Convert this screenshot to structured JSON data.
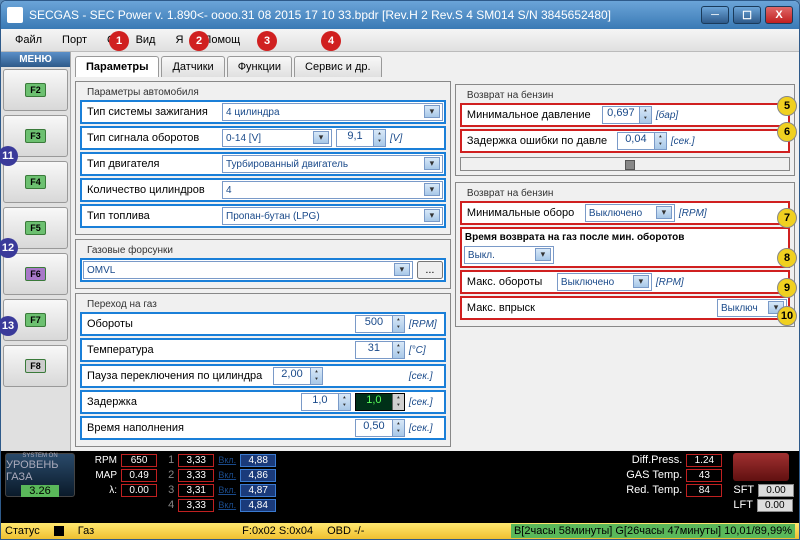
{
  "title": "SECGAS - SEC Power v. 1.890<- oooo.31 08 2015 17 10 33.bpdr [Rev.H 2 Rev.S 4 SM014  S/N 3845652480]",
  "menu": [
    "Файл",
    "Порт",
    "О",
    "Вид",
    "Я",
    "Помощ"
  ],
  "sidebar_header": "МЕНЮ",
  "fkeys": [
    "F2",
    "F3",
    "F4",
    "F5",
    "F6",
    "F7",
    "F8"
  ],
  "tabs": [
    "Параметры",
    "Датчики",
    "Функции",
    "Сервис и др."
  ],
  "group1": {
    "legend": "Параметры автомобиля",
    "ignition_label": "Тип системы зажигания",
    "ignition_value": "4 цилиндра",
    "rpm_signal_label": "Тип сигнала оборотов",
    "rpm_signal_value": "0-14 [V]",
    "rpm_signal_extra": "9,1",
    "rpm_signal_unit": "[V]",
    "engine_label": "Тип двигателя",
    "engine_value": "Турбированный двигатель",
    "cyl_label": "Количество цилиндров",
    "cyl_value": "4",
    "fuel_label": "Тип топлива",
    "fuel_value": "Пропан-бутан (LPG)"
  },
  "group2": {
    "legend": "Газовые форсунки",
    "injector_value": "OMVL",
    "btn": "..."
  },
  "group3": {
    "legend": "Переход на газ",
    "rpm_label": "Обороты",
    "rpm_value": "500",
    "rpm_unit": "[RPM]",
    "temp_label": "Температура",
    "temp_value": "31",
    "temp_unit": "[°C]",
    "pause_label": "Пауза переключения по цилиндра",
    "pause_value": "2,00",
    "pause_unit": "[сек.]",
    "delay_label": "Задержка",
    "delay_value": "1,0",
    "delay_dark": "1,0",
    "delay_unit": "[сек.]",
    "fill_label": "Время наполнения",
    "fill_value": "0,50",
    "fill_unit": "[сек.]"
  },
  "right1": {
    "legend": "Возврат на бензин",
    "minp_label": "Минимальное давление",
    "minp_value": "0,697",
    "minp_unit": "[бар]",
    "delay_label": "Задержка ошибки по давле",
    "delay_value": "0,04",
    "delay_unit": "[сек.]"
  },
  "right2": {
    "legend": "Возврат на бензин",
    "minrpm_label": "Минимальные оборо",
    "minrpm_value": "Выключено",
    "minrpm_unit": "[RPM]",
    "return_label": "Время возврата на газ после мин. оборотов",
    "return_value": "Выкл.",
    "maxrpm_label": "Макс. обороты",
    "maxrpm_value": "Выключено",
    "maxrpm_unit": "[RPM]",
    "maxinj_label": "Макс. впрыск",
    "maxinj_value": "Выключ"
  },
  "footer": {
    "rpm_label": "RPM",
    "rpm_value": "650",
    "map_label": "MAP",
    "map_value": "0.49",
    "lambda_label": "λ:",
    "lambda_value": "0.00",
    "level_label": "УРОВЕНЬ ГАЗА",
    "level_value": "3.26",
    "col1": [
      "3,33",
      "3,33",
      "3,31",
      "3,33"
    ],
    "vkl": "Вкл.",
    "col2": [
      "4,88",
      "4,86",
      "4,87",
      "4,84"
    ],
    "diff_label": "Diff.Press.",
    "diff_value": "1.24",
    "gas_label": "GAS Temp.",
    "gas_value": "43",
    "red_label": "Red. Temp.",
    "red_value": "84",
    "sft_label": "SFT",
    "sft_value": "0.00",
    "lft_label": "LFT",
    "lft_value": "0.00"
  },
  "status": {
    "label": "Статус",
    "gas": "Газ",
    "fs": "F:0x02 S:0x04",
    "obd": "OBD -/-",
    "time": "B[2часы 58минуты] G[26часы 47минуты] 10,01/89,99%"
  },
  "callouts_red": [
    "1",
    "2",
    "3",
    "4"
  ],
  "callouts_blue": [
    "11",
    "12",
    "13"
  ],
  "callouts_yellow": [
    "5",
    "6",
    "7",
    "8",
    "9",
    "10"
  ]
}
